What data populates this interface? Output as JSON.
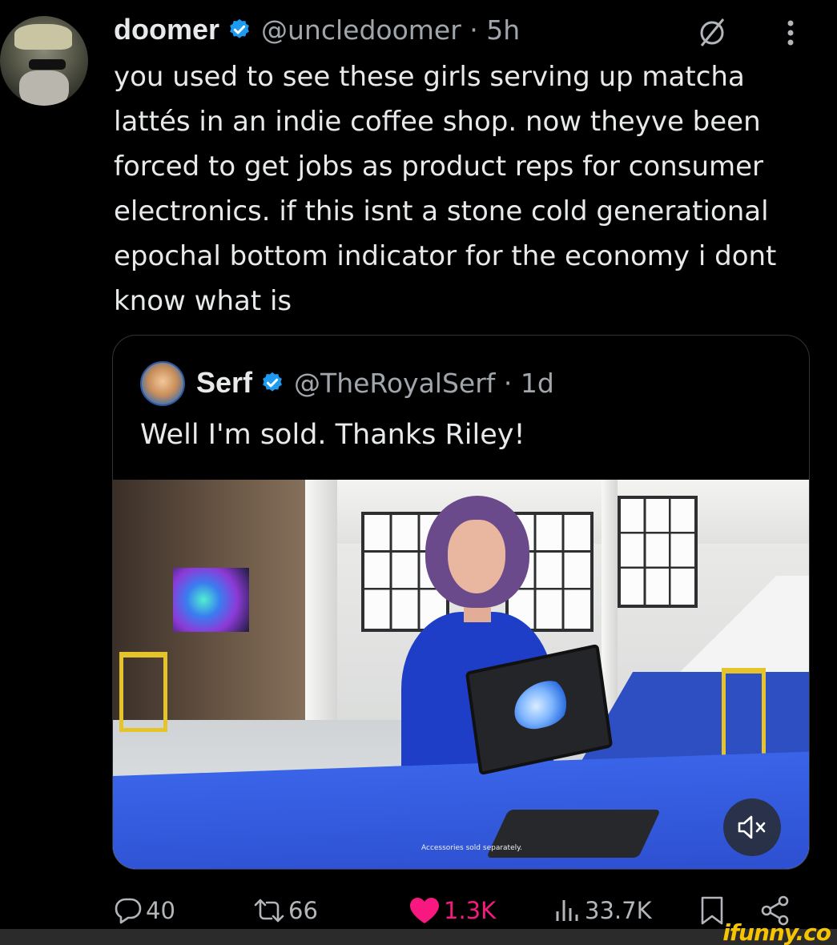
{
  "tweet": {
    "author_name": "doomer",
    "author_handle": "@uncledoomer · 5h",
    "text": "you used to see these girls serving up matcha lattés in an indie coffee shop. now theyve been forced to get jobs as product reps for consumer electronics. if this isnt a stone cold generational epochal bottom indicator for the economy i dont know what is"
  },
  "quote": {
    "author_name": "Serf",
    "author_handle": "@TheRoyalSerf · 1d",
    "text": "Well I'm sold. Thanks Riley!",
    "media_caption": "Accessories sold separately."
  },
  "actions": {
    "replies": "40",
    "reposts": "66",
    "likes": "1.3K",
    "views": "33.7K"
  },
  "watermark": "ifunny.co",
  "colors": {
    "background": "#000000",
    "text": "#e7e9ea",
    "muted": "#a0a6ab",
    "verified": "#1d9bf0",
    "like": "#f91880",
    "watermark": "#f7c400"
  },
  "icons": [
    "grok-icon",
    "more-icon",
    "verified-badge-icon",
    "reply-icon",
    "repost-icon",
    "like-icon",
    "views-icon",
    "bookmark-icon",
    "share-icon",
    "mute-icon"
  ]
}
